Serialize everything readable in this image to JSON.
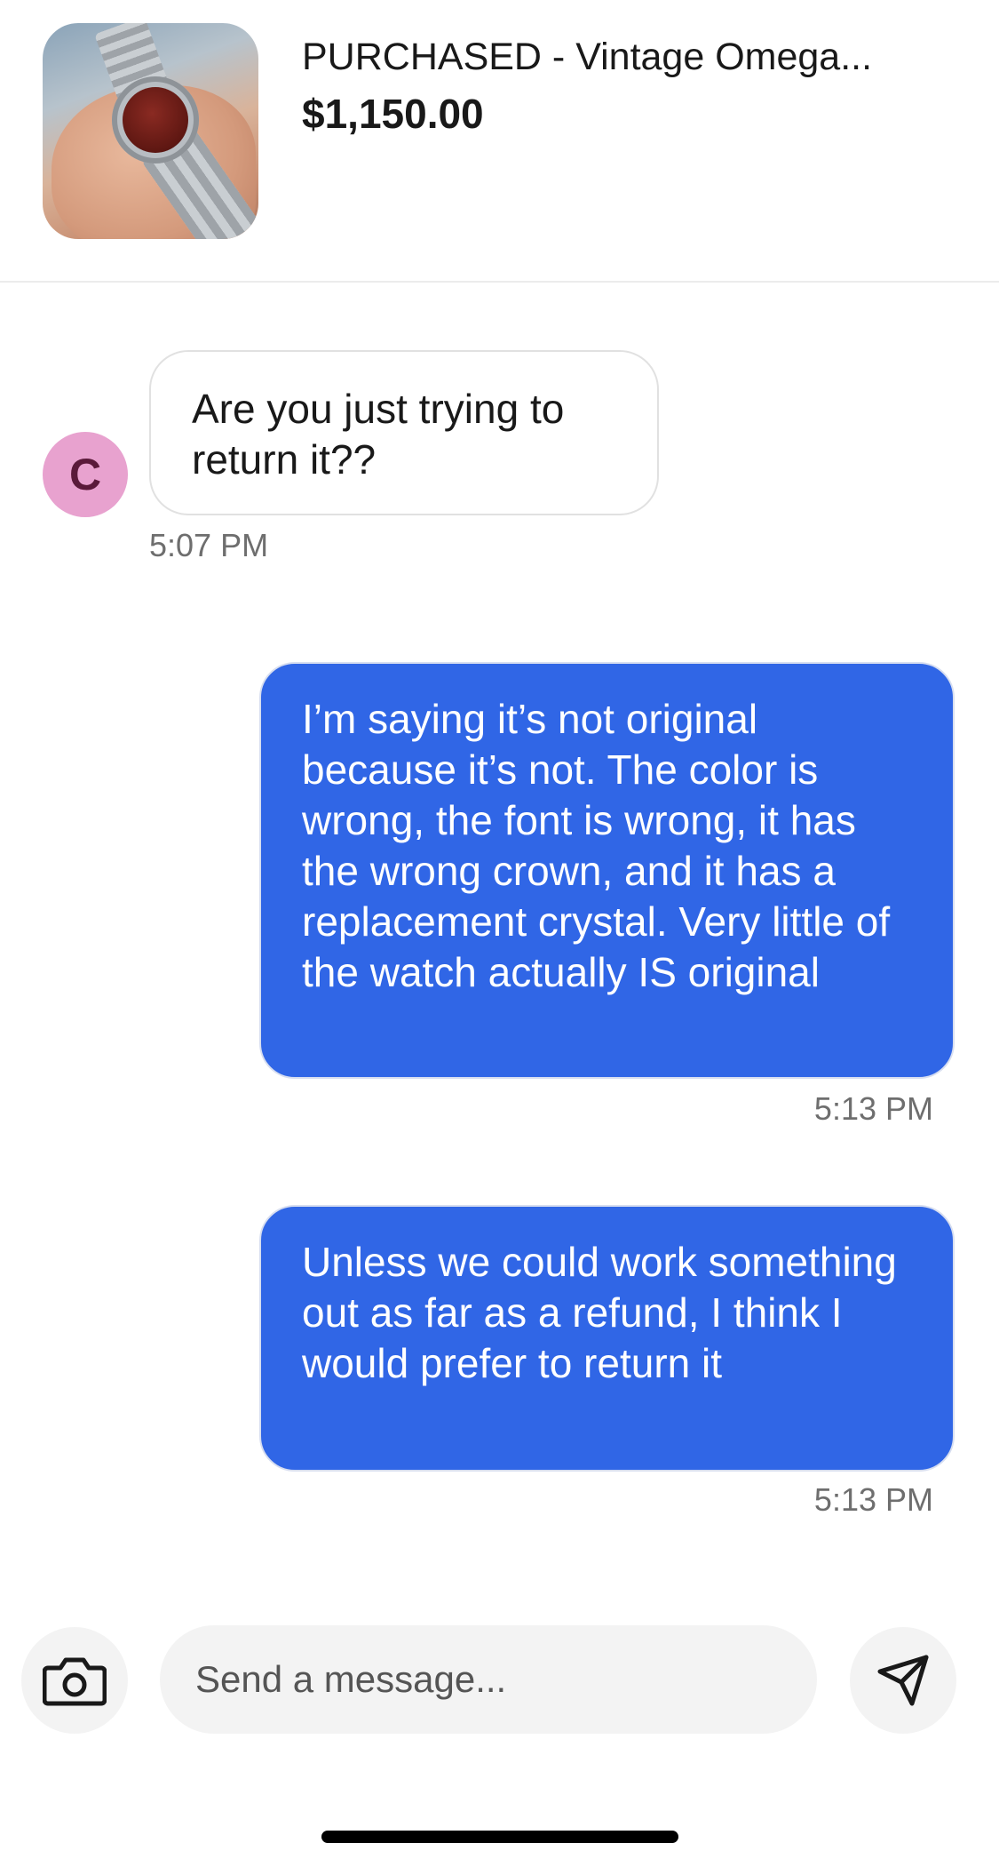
{
  "listing": {
    "title": "PURCHASED - Vintage Omega...",
    "price": "$1,150.00",
    "thumbnail_icon": "watch-photo"
  },
  "conversation": {
    "contact_initial": "C",
    "messages": [
      {
        "direction": "incoming",
        "text": "Are you just trying to return it??",
        "time": "5:07 PM"
      },
      {
        "direction": "outgoing",
        "text": "I’m saying it’s not original because it’s not. The color is wrong, the font is wrong, it has the wrong crown, and it has a replacement crystal. Very little of the watch actually IS original",
        "time": "5:13 PM"
      },
      {
        "direction": "outgoing",
        "text": "Unless we could work something out as far as a refund, I think I would prefer to return it",
        "time": "5:13 PM"
      }
    ]
  },
  "composer": {
    "placeholder": "Send a message...",
    "camera_icon": "camera-icon",
    "send_icon": "send-icon"
  },
  "colors": {
    "outgoing_bubble": "#3066e6",
    "avatar": "#e8a2cf"
  }
}
